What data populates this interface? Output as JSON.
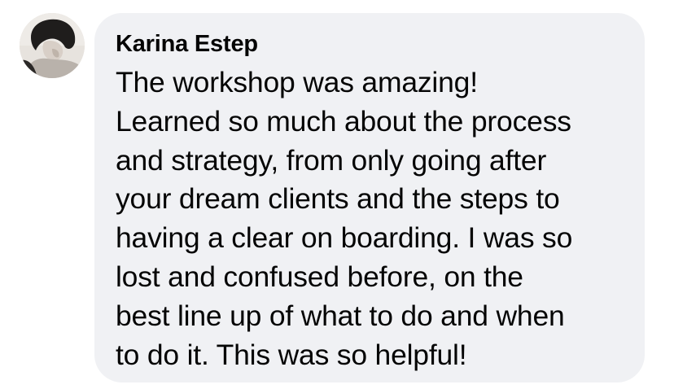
{
  "comment": {
    "author": "Karina Estep",
    "text": "The workshop was amazing!\nLearned so much about the process\nand strategy, from only going after\nyour dream clients and the steps to\nhaving a clear on boarding. I was so\nlost and confused before, on the\nbest line up of what to do and when\nto do it. This was so helpful!",
    "avatar_icon": "profile-photo-icon"
  },
  "colors": {
    "bubble_background": "#f0f1f4",
    "text": "#050505"
  }
}
